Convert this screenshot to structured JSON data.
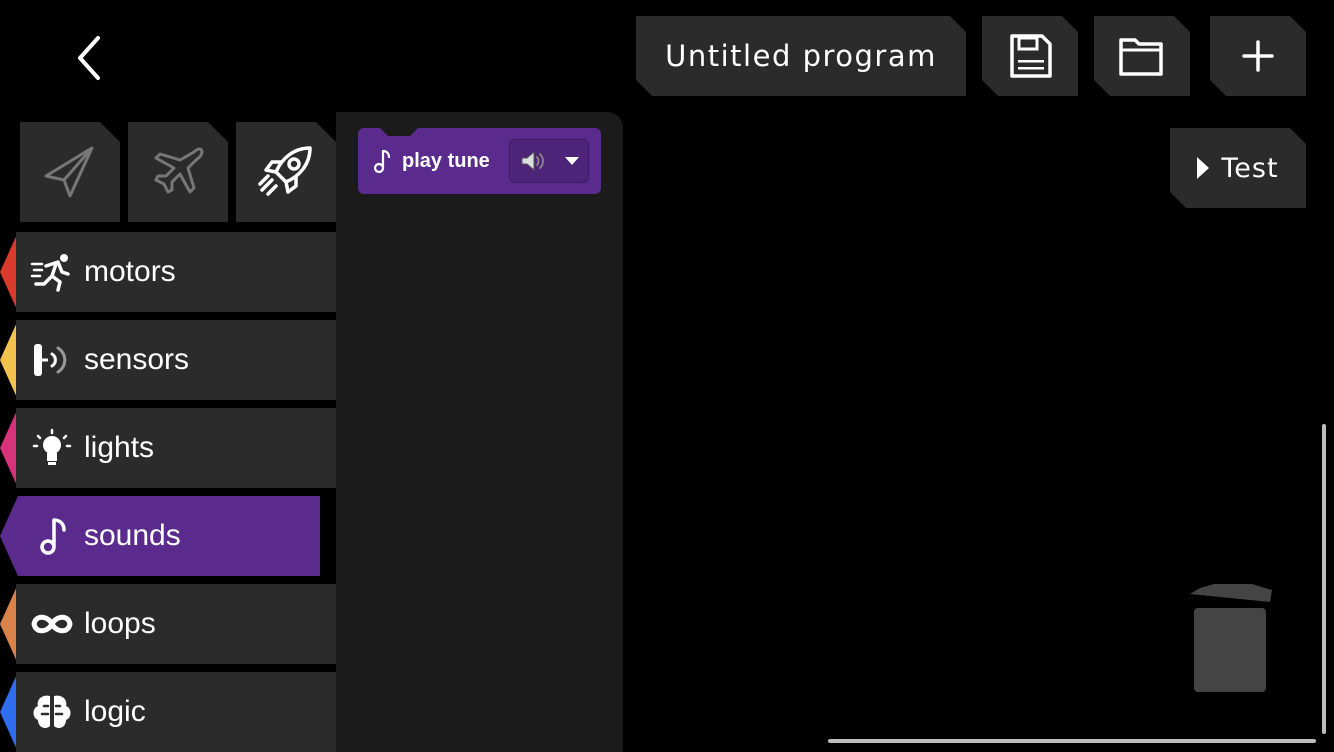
{
  "header": {
    "program_title": "Untitled program",
    "back_icon": "chevron-left-icon",
    "save_icon": "floppy-disk-icon",
    "open_icon": "folder-icon",
    "new_icon": "plus-icon"
  },
  "test_button": {
    "label": "Test",
    "icon": "play-triangle-icon"
  },
  "device_tabs": [
    {
      "icon": "paper-plane-icon"
    },
    {
      "icon": "airplane-icon"
    },
    {
      "icon": "rocket-icon",
      "selected": true
    }
  ],
  "categories": [
    {
      "label": "motors",
      "icon": "running-person-icon",
      "color": "#d93a2b"
    },
    {
      "label": "sensors",
      "icon": "sensor-wave-icon",
      "color": "#f2c14e"
    },
    {
      "label": "lights",
      "icon": "lightbulb-icon",
      "color": "#d6337a"
    },
    {
      "label": "sounds",
      "icon": "music-note-icon",
      "color": "#5a2b8c",
      "active": true
    },
    {
      "label": "loops",
      "icon": "infinity-icon",
      "color": "#d9834a"
    },
    {
      "label": "logic",
      "icon": "brain-icon",
      "color": "#2f6df0"
    }
  ],
  "palette": {
    "blocks": [
      {
        "label": "play tune",
        "icon": "music-note-icon",
        "dropdown_icon": "speaker-icon"
      }
    ]
  },
  "workspace": {
    "trash_icon": "trash-can-icon"
  },
  "colors": {
    "accent": "#5a2b8c",
    "panel": "#2b2b2b",
    "palette_bg": "#1b1b1c"
  }
}
